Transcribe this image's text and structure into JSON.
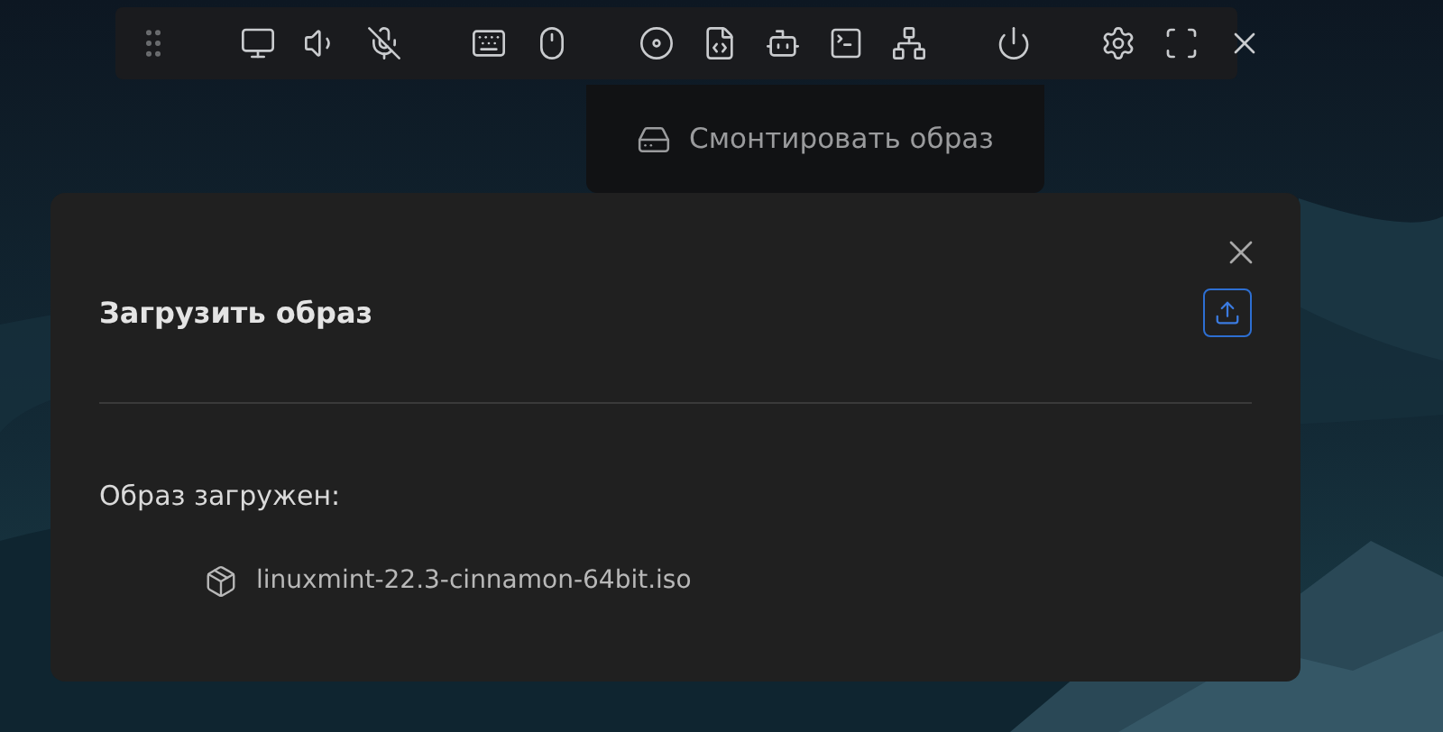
{
  "mount_menu": {
    "label": "Смонтировать образ"
  },
  "dialog": {
    "title": "Загрузить образ",
    "status_label": "Образ загружен:",
    "file": {
      "name": "linuxmint-22.3-cinnamon-64bit.iso"
    }
  }
}
